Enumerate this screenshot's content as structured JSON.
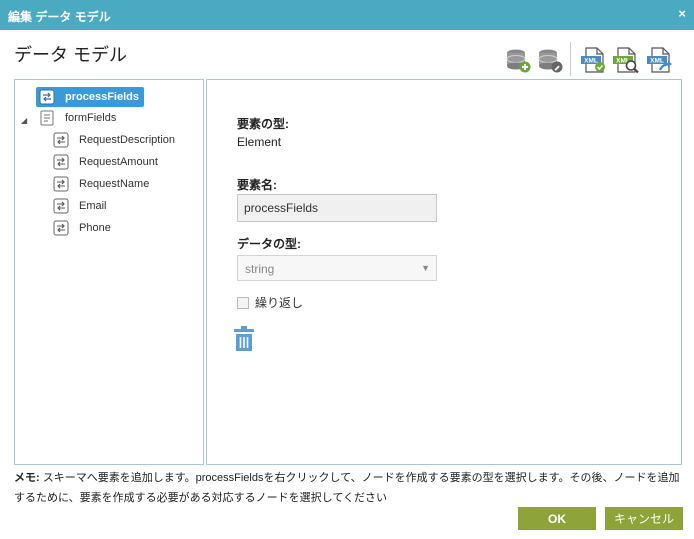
{
  "window": {
    "title": "編集 データ モデル",
    "close_symbol": "×"
  },
  "page_title": "データ モデル",
  "toolbar": {
    "icons": [
      "database-add-icon",
      "database-edit-icon",
      "xml-validate-icon",
      "xml-search-icon",
      "xml-export-icon"
    ],
    "xml_text": "XML"
  },
  "tree": {
    "root": "processFields",
    "group": "formFields",
    "expander": "◢",
    "children": [
      "RequestDescription",
      "RequestAmount",
      "RequestName",
      "Email",
      "Phone"
    ]
  },
  "detail": {
    "element_type_label": "要素の型:",
    "element_type_value": "Element",
    "element_name_label": "要素名:",
    "element_name_value": "processFields",
    "data_type_label": "データの型:",
    "data_type_value": "string",
    "repeat_label": "繰り返し"
  },
  "memo": {
    "prefix": "メモ:",
    "text": " スキーマへ要素を追加します。processFieldsを右クリックして、ノードを作成する要素の型を選択します。その後、ノードを追加するために、要素を作成する必要がある対応するノードを選択してください"
  },
  "buttons": {
    "ok": "OK",
    "cancel": "キャンセル"
  },
  "colors": {
    "title_bar": "#4aaac2",
    "selection": "#3a9ad9",
    "button": "#8ea439",
    "panel_border": "#a9c7d6",
    "icon_blue": "#4a8bc2",
    "db_green": "#6da83a"
  }
}
